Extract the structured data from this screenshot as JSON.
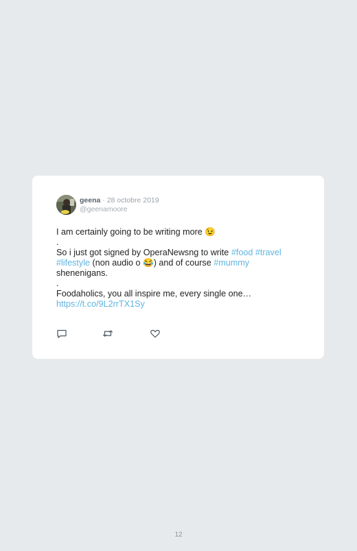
{
  "tweet": {
    "author_name": "geena",
    "date": "28 octobre 2019",
    "date_separator": " · ",
    "handle": "@geenamoore",
    "lines": {
      "l1": "I am certainly going to be writing more 😉",
      "dot1": ".",
      "l2_start": "So i just got signed by OperaNewsng to write ",
      "tag_food": "#food",
      "tag_travel": "#travel",
      "tag_lifestyle": "#lifestyle",
      "l3_mid": " (non audio o 😂) and of course ",
      "tag_mummy": "#mummy",
      "l4": "shenenigans.",
      "dot2": ".",
      "l5": "Foodaholics, you all inspire me, every single one…",
      "url": "https://t.co/9L2rrTX1Sy"
    }
  },
  "icons": [
    "reply-icon",
    "retweet-icon",
    "like-icon"
  ],
  "footer": {
    "page_number": "12"
  },
  "colors": {
    "background": "#e6eaed",
    "link": "#5fb4e0",
    "card": "#ffffff"
  }
}
